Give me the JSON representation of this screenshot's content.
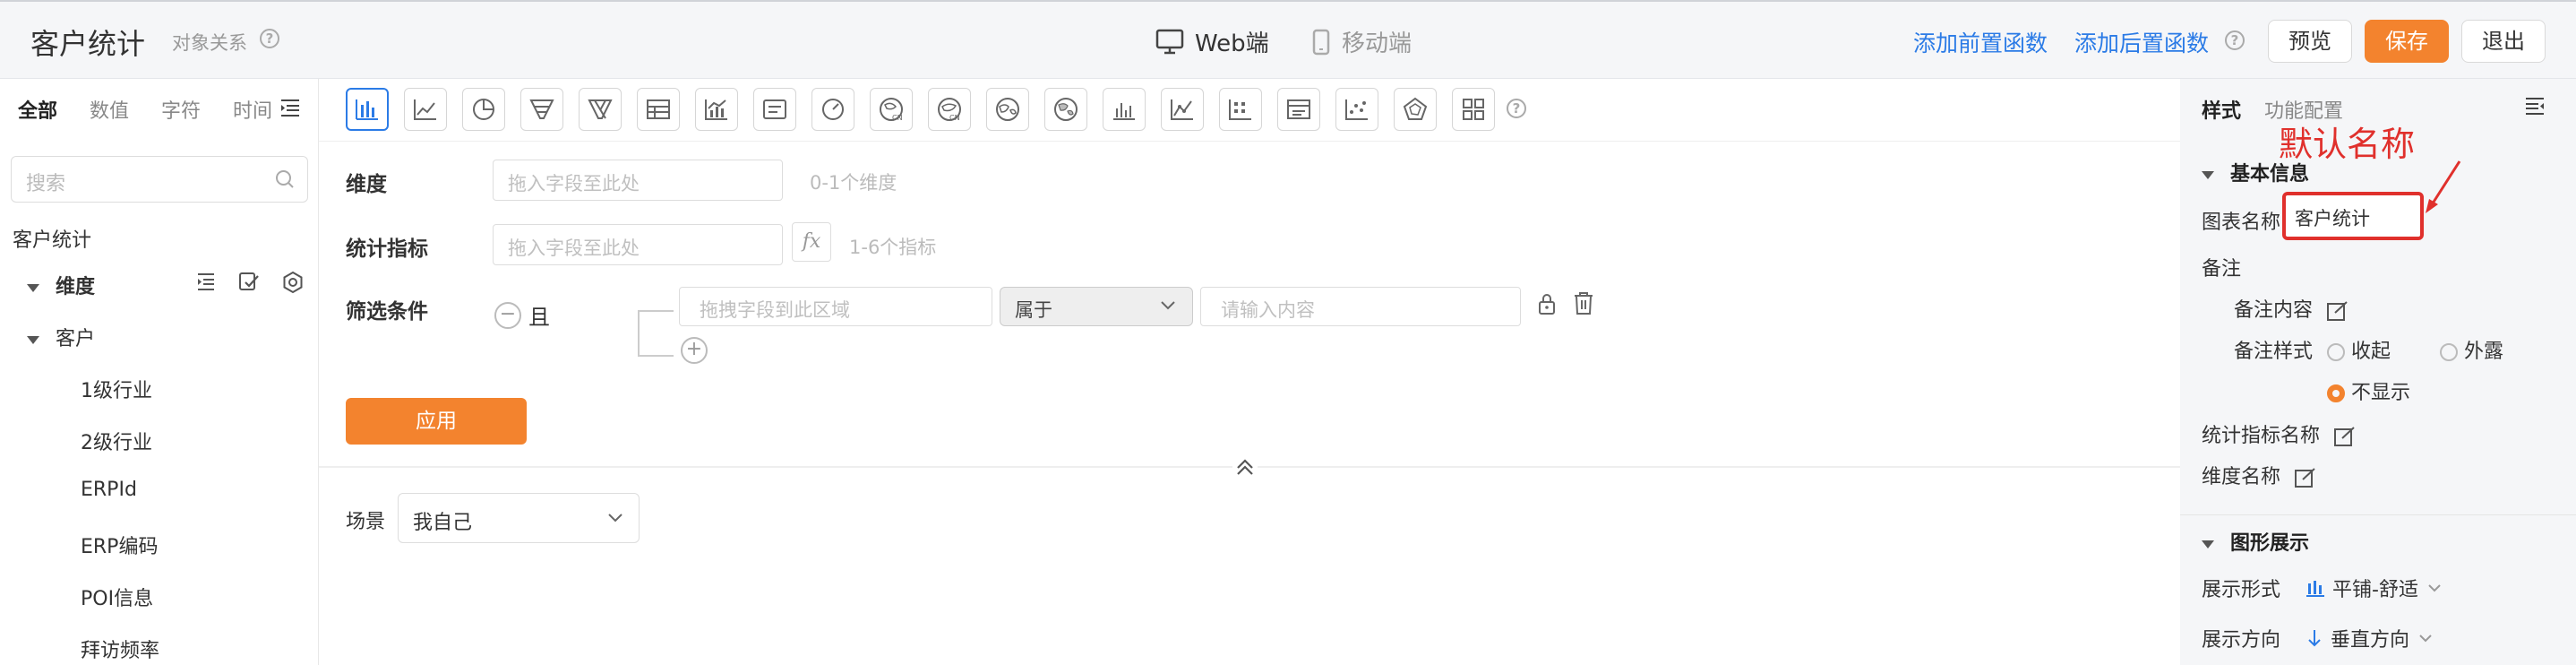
{
  "header": {
    "title": "客户统计",
    "subtitle": "对象关系",
    "web_label": "Web端",
    "mobile_label": "移动端",
    "add_pre_fn": "添加前置函数",
    "add_post_fn": "添加后置函数",
    "preview": "预览",
    "save": "保存",
    "exit": "退出",
    "accent": "#f3832e",
    "link_color": "#2b7be6"
  },
  "left": {
    "tabs": [
      "全部",
      "数值",
      "字符",
      "时间"
    ],
    "search_placeholder": "搜索",
    "root": "客户统计",
    "dimension": "维度",
    "group": "客户",
    "fields": [
      "1级行业",
      "2级行业",
      "ERPId",
      "ERP编码",
      "POI信息",
      "拜访频率"
    ]
  },
  "center": {
    "chart_types": [
      "bar",
      "line",
      "pie",
      "funnel",
      "funnel2",
      "table",
      "combo",
      "text",
      "gauge",
      "map-cn",
      "map-cn2",
      "map-world",
      "map-world2",
      "column",
      "trend",
      "pivot",
      "card",
      "scatter",
      "radar",
      "grid"
    ],
    "dimension_label": "维度",
    "dimension_placeholder": "拖入字段至此处",
    "dimension_hint": "0-1个维度",
    "metric_label": "统计指标",
    "metric_placeholder": "拖入字段至此处",
    "metric_hint": "1-6个指标",
    "filter_label": "筛选条件",
    "and_label": "且",
    "filter_field_placeholder": "拖拽字段到此区域",
    "filter_op": "属于",
    "filter_value_placeholder": "请输入内容",
    "apply": "应用",
    "scene_label": "场景",
    "scene_value": "我自己"
  },
  "right": {
    "tabs": [
      "样式",
      "功能配置"
    ],
    "annotation": "默认名称",
    "basic_info": "基本信息",
    "chart_name_label": "图表名称",
    "chart_name_value": "客户统计",
    "remark": "备注",
    "remark_content": "备注内容",
    "remark_style": "备注样式",
    "opt_collapse": "收起",
    "opt_expose": "外露",
    "opt_hide": "不显示",
    "metric_name": "统计指标名称",
    "dimension_name": "维度名称",
    "graphic_display": "图形展示",
    "display_form_label": "展示形式",
    "display_form_value": "平铺-舒适",
    "display_dir_label": "展示方向",
    "display_dir_value": "垂直方向"
  }
}
